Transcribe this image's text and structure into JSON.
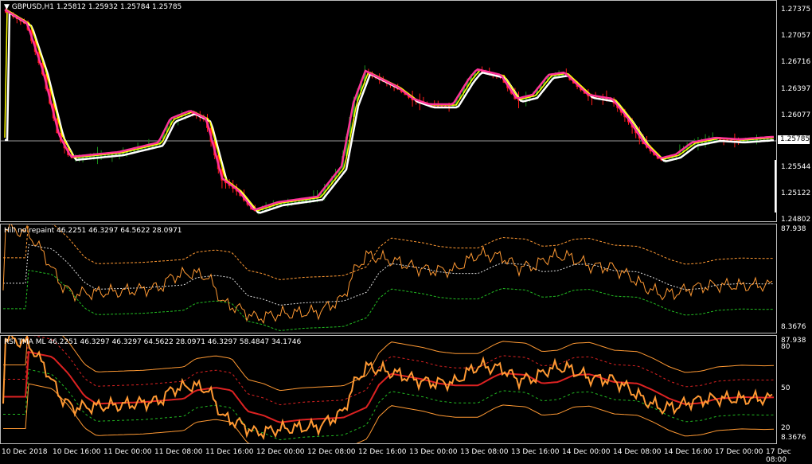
{
  "main": {
    "symbol_line": "GBPUSD,H1  1.25812 1.25932 1.25784 1.25785",
    "prices": [
      "1.27375",
      "1.27057",
      "1.26716",
      "1.26397",
      "1.26077",
      "1.25544",
      "1.25122",
      "1.24802"
    ],
    "current_price": "1.25785"
  },
  "hill": {
    "label": "Hill no repaint 46.2251 46.3297 64.5622 28.0971",
    "max": "87.938",
    "min": "8.3676"
  },
  "rsi": {
    "label": "RSI TMA ML 46.2251 46.3297 46.3297 64.5622 28.0971 46.3297 58.4847 34.1746",
    "max": "87.938",
    "levels": [
      "80",
      "50",
      "20"
    ],
    "min": "8.3676"
  },
  "time_labels": [
    "10 Dec 2018",
    "10 Dec 16:00",
    "11 Dec 00:00",
    "11 Dec 08:00",
    "11 Dec 16:00",
    "12 Dec 00:00",
    "12 Dec 08:00",
    "12 Dec 16:00",
    "13 Dec 00:00",
    "13 Dec 08:00",
    "13 Dec 16:00",
    "14 Dec 00:00",
    "14 Dec 08:00",
    "14 Dec 16:00",
    "17 Dec 00:00",
    "17 Dec 08:00"
  ],
  "colors": {
    "bull": "#1a8f1a",
    "bear": "#ff1a1a",
    "ma_pink": "#ff3399",
    "ma_white": "#ffffff",
    "ma_yellow": "#ffff00",
    "orange": "#ff9933",
    "green": "#22bb22",
    "red": "#dd2222"
  }
}
